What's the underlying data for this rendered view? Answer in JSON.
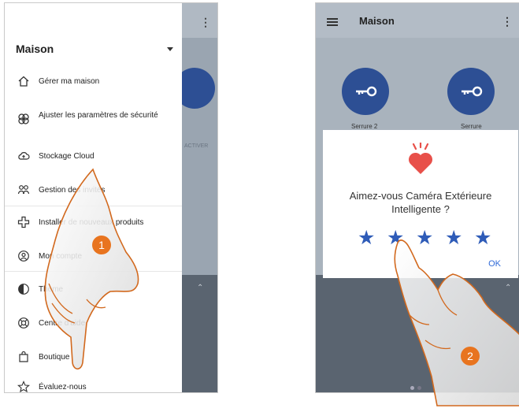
{
  "left": {
    "drawer": {
      "title": "Maison",
      "items": [
        {
          "label": "Gérer ma maison",
          "icon": "home-icon"
        },
        {
          "label": "Ajuster les paramètres de sécurité",
          "icon": "security-settings-icon"
        },
        {
          "label": "Stockage Cloud",
          "icon": "cloud-icon"
        },
        {
          "label": "Gestion des invités",
          "icon": "guests-icon"
        },
        {
          "label": "Installer de nouveaux produits",
          "icon": "add-product-icon"
        },
        {
          "label": "Mon compte",
          "icon": "account-icon"
        },
        {
          "label": "Thème",
          "icon": "theme-icon"
        },
        {
          "label": "Centre d'aide",
          "icon": "help-icon"
        },
        {
          "label": "Boutique",
          "icon": "shop-icon"
        },
        {
          "label": "Évaluez-nous",
          "icon": "star-outline-icon"
        }
      ]
    },
    "background": {
      "activer_label": "ACTIVER"
    },
    "step_badge": "1"
  },
  "right": {
    "header": {
      "title": "Maison"
    },
    "devices": [
      {
        "label": "Serrure 2"
      },
      {
        "label": "Serrure"
      }
    ],
    "dialog": {
      "question_line1": "Aimez-vous Caméra Extérieure",
      "question_line2": "Intelligente ?",
      "stars": 5,
      "ok_label": "OK",
      "accent_color": "#2f5cb8",
      "heart_color": "#e8504a"
    },
    "step_badge": "2"
  },
  "colors": {
    "badge": "#e8741f",
    "hand_outline": "#d2691e"
  }
}
